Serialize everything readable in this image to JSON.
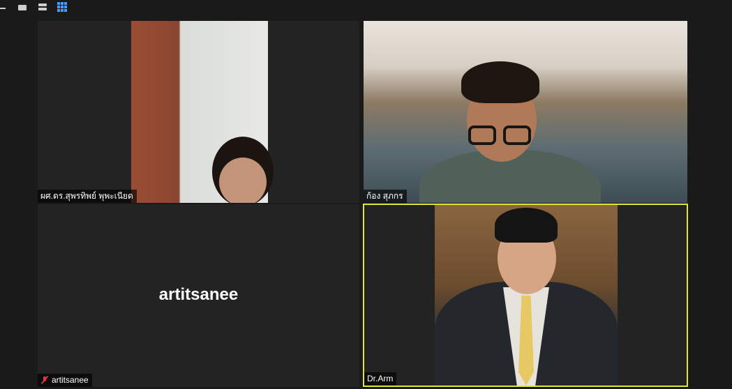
{
  "toolbar": {
    "icons": [
      "minimize-icon",
      "speaker-view-icon",
      "stacked-view-icon",
      "gallery-view-icon"
    ],
    "active_view": "gallery",
    "accent_color": "#4c9cff"
  },
  "participants": [
    {
      "name": "ผศ.ดร.สุพรทิพย์ พุพะเนียด",
      "video_on": true,
      "muted": false
    },
    {
      "name": "ก้อง สุภกร",
      "video_on": true,
      "muted": false
    },
    {
      "name": "artitsanee",
      "display_text": "artitsanee",
      "video_on": false,
      "muted": true
    },
    {
      "name": "Dr.Arm",
      "video_on": true,
      "muted": false,
      "active_speaker": true
    }
  ],
  "colors": {
    "background": "#1a1a1a",
    "tile": "#232323",
    "active_speaker_border": "#dfe63c",
    "muted_icon": "#e23a3a"
  }
}
